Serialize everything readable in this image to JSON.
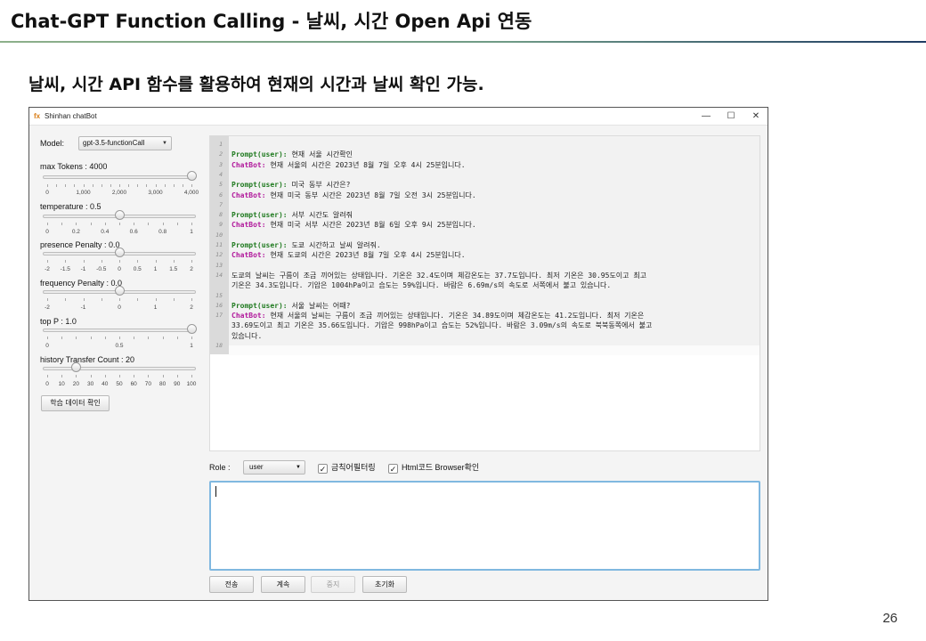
{
  "slide": {
    "title": "Chat-GPT Function Calling - 날씨, 시간 Open Api 연동",
    "subtitle": "날씨, 시간 API 함수를 활용하여 현재의 시간과 날씨 확인 가능.",
    "page_number": "26"
  },
  "window": {
    "icon": "fx",
    "title": "Shinhan chatBot",
    "minimize": "—",
    "maximize": "☐",
    "close": "✕"
  },
  "sidebar": {
    "model_label": "Model:",
    "model_value": "gpt-3.5-functionCall",
    "max_tokens_label": "max Tokens : 4000",
    "max_tokens_level": 1.0,
    "max_tokens_ticks": [
      "0",
      "1,000",
      "2,000",
      "3,000",
      "4,000"
    ],
    "temperature_label": "temperature : 0.5",
    "temperature_level": 0.5,
    "temperature_ticks": [
      "0",
      "0.2",
      "0.4",
      "0.6",
      "0.8",
      "1"
    ],
    "presence_label": "presence Penalty : 0.0",
    "presence_level": 0.0,
    "presence_ticks": [
      "-2",
      "-1.5",
      "-1",
      "-0.5",
      "0",
      "0.5",
      "1",
      "1.5",
      "2"
    ],
    "frequency_label": "frequency Penalty : 0.0",
    "frequency_level": 0.0,
    "frequency_ticks": [
      "-2",
      "-1",
      "0",
      "1",
      "2"
    ],
    "top_p_label": "top P : 1.0",
    "top_p_level": 1.0,
    "top_p_ticks": [
      "0",
      "0.5",
      "1"
    ],
    "history_label": "history Transfer Count : 20",
    "history_level": 20,
    "history_ticks": [
      "0",
      "10",
      "20",
      "30",
      "40",
      "50",
      "60",
      "70",
      "80",
      "90",
      "100"
    ],
    "training_button": "학습 데이터 확인"
  },
  "chat": {
    "lines": [
      {
        "num": "1",
        "tag": "",
        "text": ""
      },
      {
        "num": "2",
        "tag": "Prompt(user):",
        "text": " 현재 서울 시간확인"
      },
      {
        "num": "3",
        "tag": "ChatBot:",
        "text": " 현재 서울의 시간은 2023년 8월 7일 오후 4시 25분입니다."
      },
      {
        "num": "4",
        "tag": "",
        "text": ""
      },
      {
        "num": "5",
        "tag": "Prompt(user):",
        "text": " 미국 동부 시간은?"
      },
      {
        "num": "6",
        "tag": "ChatBot:",
        "text": " 현재 미국 동부 시간은 2023년 8월 7일 오전 3시 25분입니다."
      },
      {
        "num": "7",
        "tag": "",
        "text": ""
      },
      {
        "num": "8",
        "tag": "Prompt(user):",
        "text": " 서부 시간도 알려줘"
      },
      {
        "num": "9",
        "tag": "ChatBot:",
        "text": " 현재 미국 서부 시간은 2023년 8월 6일 오후 9시 25분입니다."
      },
      {
        "num": "10",
        "tag": "",
        "text": ""
      },
      {
        "num": "11",
        "tag": "Prompt(user):",
        "text": " 도쿄 시간하고 날씨 알려줘."
      },
      {
        "num": "12",
        "tag": "ChatBot:",
        "text": " 현재 도쿄의 시간은 2023년 8월 7일 오후 4시 25분입니다."
      },
      {
        "num": "13",
        "tag": "",
        "text": ""
      },
      {
        "num": "14",
        "tag": "",
        "text": "도쿄의 날씨는 구름이 조금 끼어있는 상태입니다. 기온은 32.4도이며 체감온도는 37.7도입니다. 최저 기온은 30.95도이고 최고"
      },
      {
        "num": "",
        "tag": "",
        "text": "기온은 34.3도입니다. 기압은 1004hPa이고 습도는 59%입니다. 바람은 6.69m/s의 속도로 서쪽에서 불고 있습니다."
      },
      {
        "num": "15",
        "tag": "",
        "text": ""
      },
      {
        "num": "16",
        "tag": "Prompt(user):",
        "text": " 서울 날씨는 어때?"
      },
      {
        "num": "17",
        "tag": "ChatBot:",
        "text": " 현재 서울의 날씨는 구름이 조금 끼어있는 상태입니다. 기온은 34.89도이며 체감온도는 41.2도입니다. 최저 기온은"
      },
      {
        "num": "",
        "tag": "",
        "text": "33.69도이고 최고 기온은 35.66도입니다. 기압은 998hPa이고 습도는 52%입니다. 바람은 3.09m/s의 속도로 북북동쪽에서 불고"
      },
      {
        "num": "",
        "tag": "",
        "text": "있습니다."
      },
      {
        "num": "18",
        "tag": "",
        "text": ""
      }
    ]
  },
  "controls": {
    "role_label": "Role :",
    "role_value": "user",
    "profanity_filter_label": "금칙어필터링",
    "profanity_filter_checked": true,
    "html_browser_label": "Html코드 Browser확인",
    "html_browser_checked": true,
    "input_value": "",
    "send_button": "전송",
    "continue_button": "계속",
    "stop_button": "중지",
    "reset_button": "초기화"
  }
}
